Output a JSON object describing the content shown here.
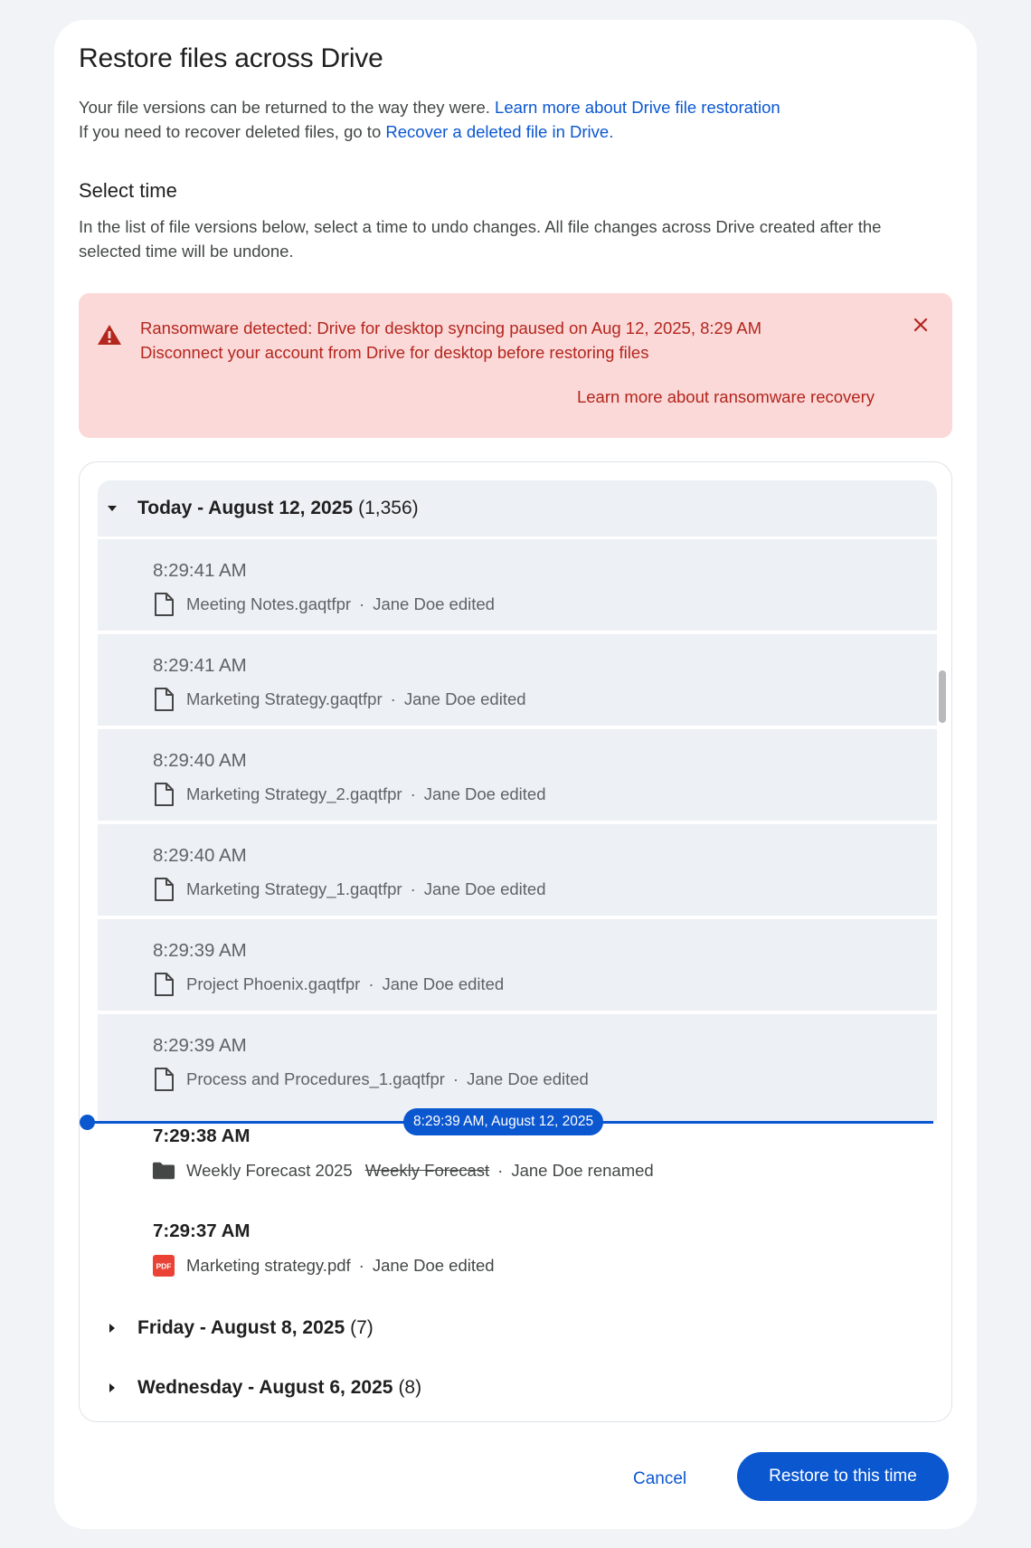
{
  "dialog": {
    "title": "Restore files across Drive",
    "intro_line1": "Your file versions can be returned to the way they were.",
    "intro_link1": "Learn more about Drive file restoration",
    "intro_line2": "If you need to recover deleted files, go to",
    "intro_link2": "Recover a deleted file in Drive",
    "intro_link2_suffix": ".",
    "section_title": "Select time",
    "section_desc": "In the list of file versions below, select a time to undo changes. All file changes across Drive created after the selected time will be undone."
  },
  "alert": {
    "title": "Ransomware detected: Drive for desktop syncing paused on Aug 12, 2025, 8:29 AM",
    "message": "Disconnect your account from Drive for desktop before restoring files",
    "link": "Learn more about ransomware recovery",
    "icon": "warning-icon",
    "color": "#b3261e",
    "background": "#fbd9d8"
  },
  "groups": [
    {
      "label": "Today - August 12, 2025",
      "count": "(1,356)",
      "expanded": true,
      "rows": [
        {
          "time": "8:29:41 AM",
          "file": "Meeting Notes.gaqtfpr",
          "old_name": "",
          "action": "Jane Doe edited",
          "icon": "file-icon"
        },
        {
          "time": "8:29:41 AM",
          "file": "Marketing Strategy.gaqtfpr",
          "old_name": "",
          "action": "Jane Doe edited",
          "icon": "file-icon"
        },
        {
          "time": "8:29:40 AM",
          "file": "Marketing Strategy_2.gaqtfpr",
          "old_name": "",
          "action": "Jane Doe edited",
          "icon": "file-icon"
        },
        {
          "time": "8:29:40 AM",
          "file": "Marketing Strategy_1.gaqtfpr",
          "old_name": "",
          "action": "Jane Doe edited",
          "icon": "file-icon"
        },
        {
          "time": "8:29:39 AM",
          "file": "Project Phoenix.gaqtfpr",
          "old_name": "",
          "action": "Jane Doe edited",
          "icon": "file-icon"
        },
        {
          "time": "8:29:39 AM",
          "file": "Process and Procedures_1.gaqtfpr",
          "old_name": "",
          "action": "Jane Doe edited",
          "icon": "file-icon"
        },
        {
          "time": "7:29:38 AM",
          "file": "Weekly Forecast 2025",
          "old_name": "Weekly Forecast",
          "action": "Jane Doe renamed",
          "icon": "folder-icon"
        },
        {
          "time": "7:29:37 AM",
          "file": "Marketing strategy.pdf",
          "old_name": "",
          "action": "Jane Doe edited",
          "icon": "pdf-icon"
        }
      ]
    },
    {
      "label": "Friday - August 8, 2025",
      "count": "(7)",
      "expanded": false
    },
    {
      "label": "Wednesday - August 6, 2025",
      "count": "(8)",
      "expanded": false
    }
  ],
  "separator": "·",
  "pdf_badge": "PDF",
  "marker": {
    "label": "8:29:39 AM, August 12, 2025"
  },
  "footer": {
    "cancel": "Cancel",
    "restore": "Restore to this time"
  },
  "colors": {
    "accent": "#0b57d0",
    "row_bg": "#edf0f4",
    "page_bg": "#f1f3f6"
  }
}
